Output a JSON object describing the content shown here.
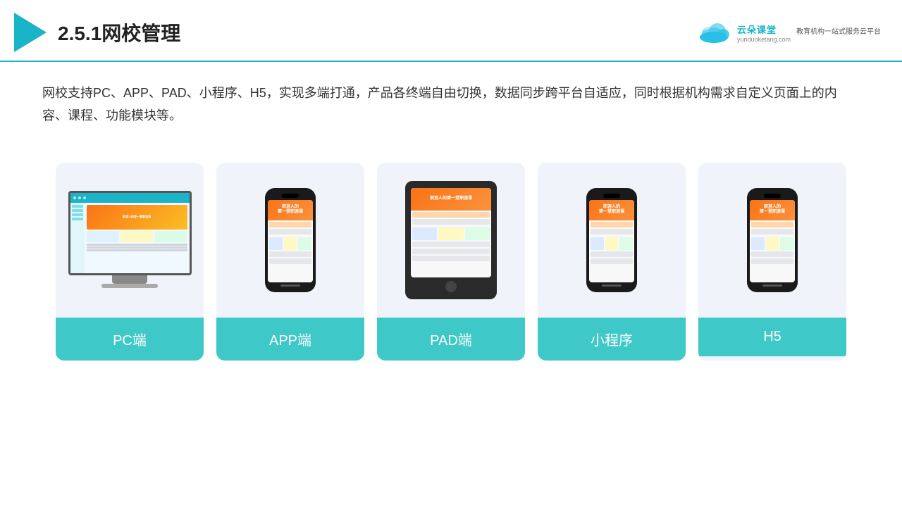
{
  "header": {
    "title": "2.5.1网校管理",
    "logo": {
      "name": "云朵课堂",
      "url": "yunduoketang.com",
      "slogan": "教育机构一站式服务云平台"
    }
  },
  "description": "网校支持PC、APP、PAD、小程序、H5，实现多端打通，产品各终端自由切换，数据同步跨平台自适应，同时根据机构需求自定义页面上的内容、课程、功能模块等。",
  "cards": [
    {
      "id": "pc",
      "label": "PC端",
      "device": "pc"
    },
    {
      "id": "app",
      "label": "APP端",
      "device": "phone"
    },
    {
      "id": "pad",
      "label": "PAD端",
      "device": "tablet"
    },
    {
      "id": "miniapp",
      "label": "小程序",
      "device": "phone"
    },
    {
      "id": "h5",
      "label": "H5",
      "device": "phone"
    }
  ]
}
